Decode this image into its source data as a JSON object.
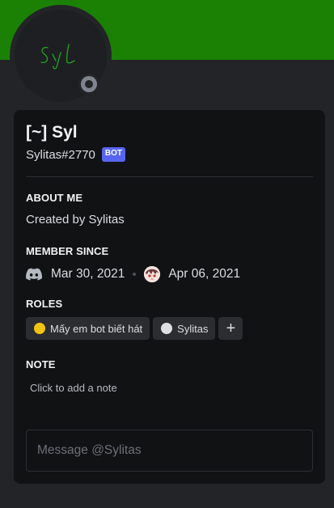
{
  "banner": {
    "color": "#1b8104"
  },
  "avatar": {
    "signature": "Syl",
    "signature_color": "#1f9e1f"
  },
  "status": {
    "state": "offline",
    "color": "#80848e"
  },
  "profile": {
    "display_name": "[~] Syl",
    "username": "Sylitas#2770",
    "badge": "BOT",
    "badge_color": "#5865f2"
  },
  "about_me": {
    "heading": "ABOUT ME",
    "text": "Created by Sylitas"
  },
  "member_since": {
    "heading": "MEMBER SINCE",
    "discord_icon": "discord-logo-icon",
    "discord_date": "Mar 30, 2021",
    "server_icon": "server-avatar-icon",
    "server_date": "Apr 06, 2021"
  },
  "roles": {
    "heading": "ROLES",
    "items": [
      {
        "name": "Mấy em bot biết hát",
        "color": "#f1c40f"
      },
      {
        "name": "Sylitas",
        "color": "#dcdfe4"
      }
    ],
    "add_label": "+"
  },
  "note": {
    "heading": "NOTE",
    "placeholder": "Click to add a note"
  },
  "message": {
    "placeholder": "Message @Sylitas"
  }
}
